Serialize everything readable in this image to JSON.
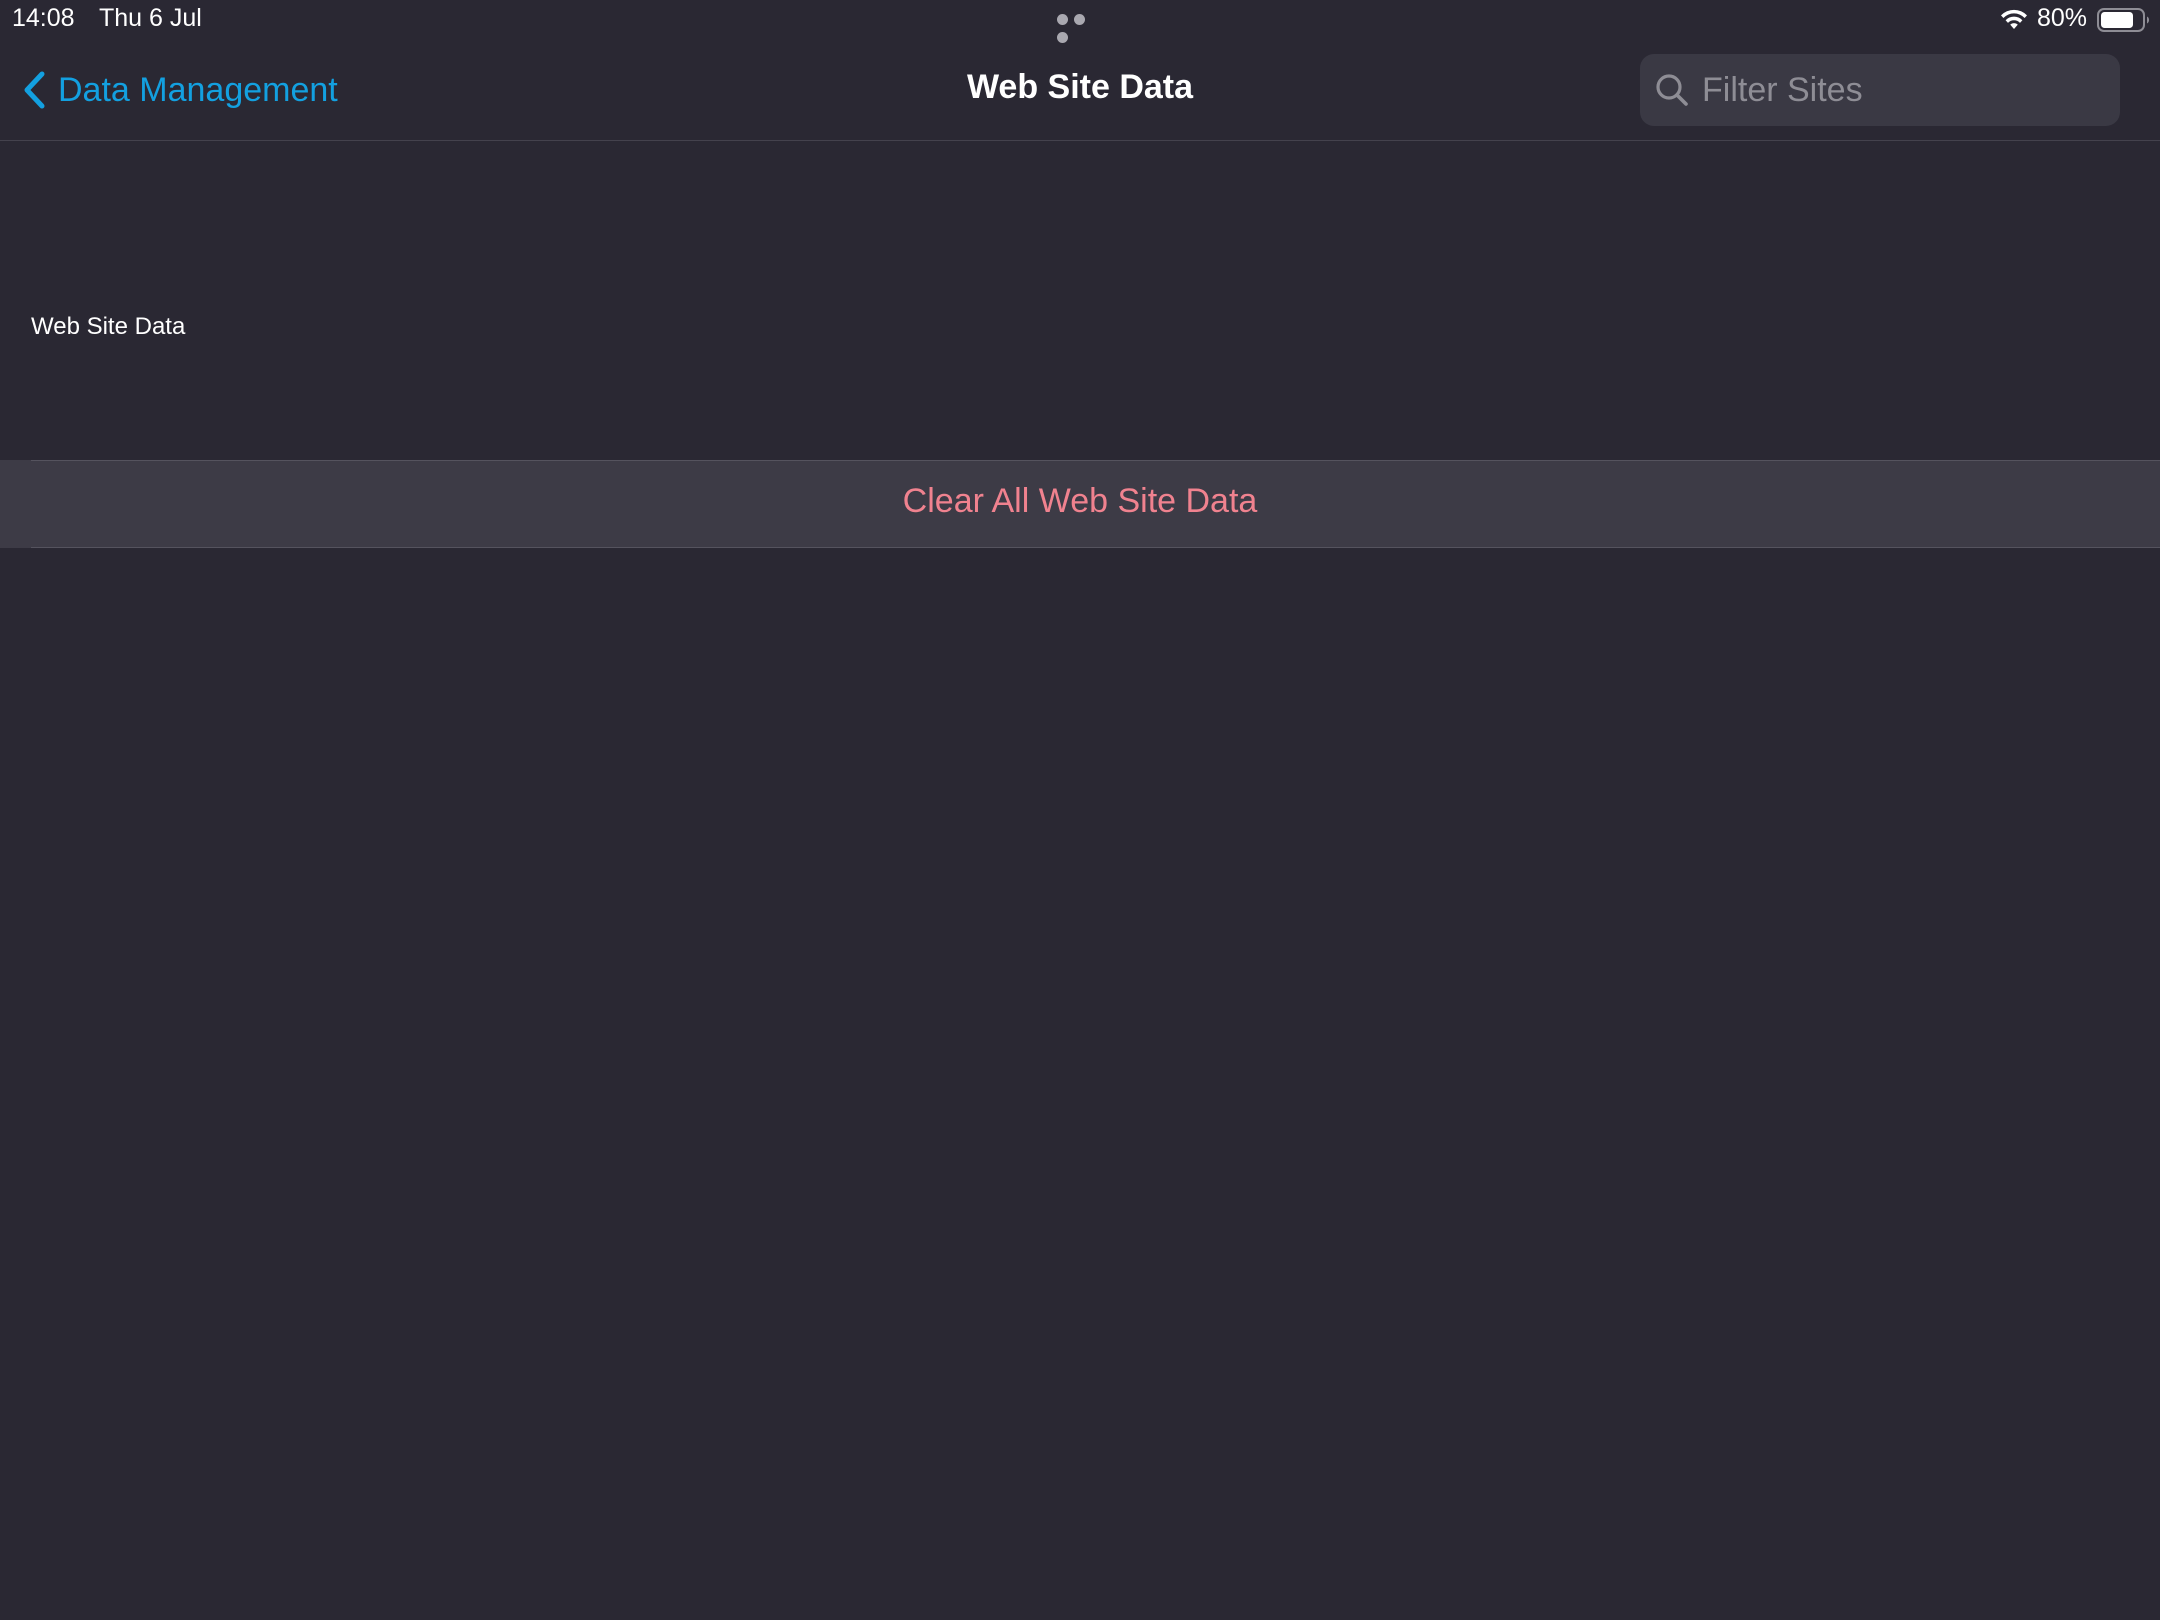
{
  "status_bar": {
    "time": "14:08",
    "date": "Thu 6 Jul",
    "battery_percent": "80%",
    "battery_level": 0.8,
    "icons": [
      "multitask-dots-icon",
      "wifi-icon",
      "battery-icon"
    ]
  },
  "nav": {
    "back_label": "Data Management",
    "title": "Web Site Data",
    "search_placeholder": "Filter Sites",
    "search_value": ""
  },
  "content": {
    "section_header": "Web Site Data",
    "clear_button_label": "Clear All Web Site Data"
  },
  "colors": {
    "background": "#2a2833",
    "accent_blue": "#13a0e0",
    "destructive": "#f0828f",
    "row_background": "#3d3b46",
    "search_background": "#3a3944"
  }
}
